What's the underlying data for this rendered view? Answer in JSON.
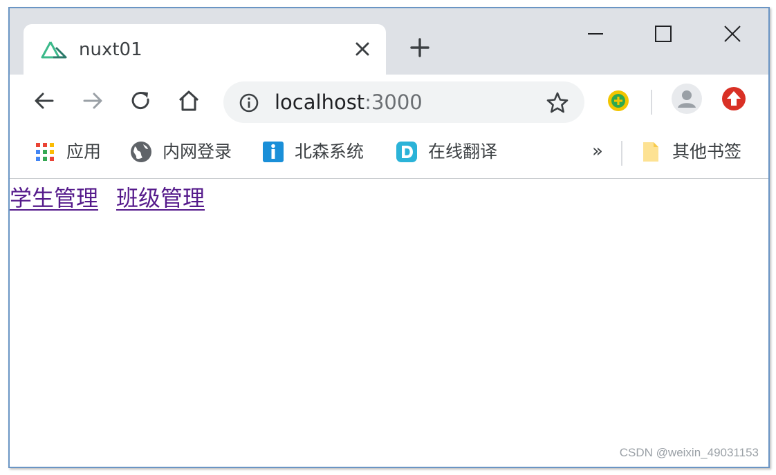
{
  "browser": {
    "tab": {
      "title": "nuxt01",
      "favicon": "nuxt-logo-icon"
    },
    "window_controls": [
      "minimize-icon",
      "maximize-icon",
      "close-icon"
    ],
    "address_bar": {
      "host": "localhost",
      "port": ":3000"
    },
    "bookmarks": [
      {
        "label": "应用",
        "icon": "apps-grid-icon"
      },
      {
        "label": "内网登录",
        "icon": "globe-icon"
      },
      {
        "label": "北森系统",
        "icon": "info-square-icon"
      },
      {
        "label": "在线翻译",
        "icon": "translate-d-icon"
      }
    ],
    "bookmarks_overflow": "»",
    "other_bookmarks": {
      "label": "其他书签",
      "icon": "folder-icon"
    }
  },
  "page": {
    "links": [
      {
        "label": "学生管理"
      },
      {
        "label": "班级管理"
      }
    ]
  },
  "watermark": "CSDN @weixin_49031153",
  "colors": {
    "visited_link": "#551a8b",
    "tab_strip": "#dee1e6",
    "omnibox": "#f1f3f4",
    "extension_red": "#d93025"
  }
}
